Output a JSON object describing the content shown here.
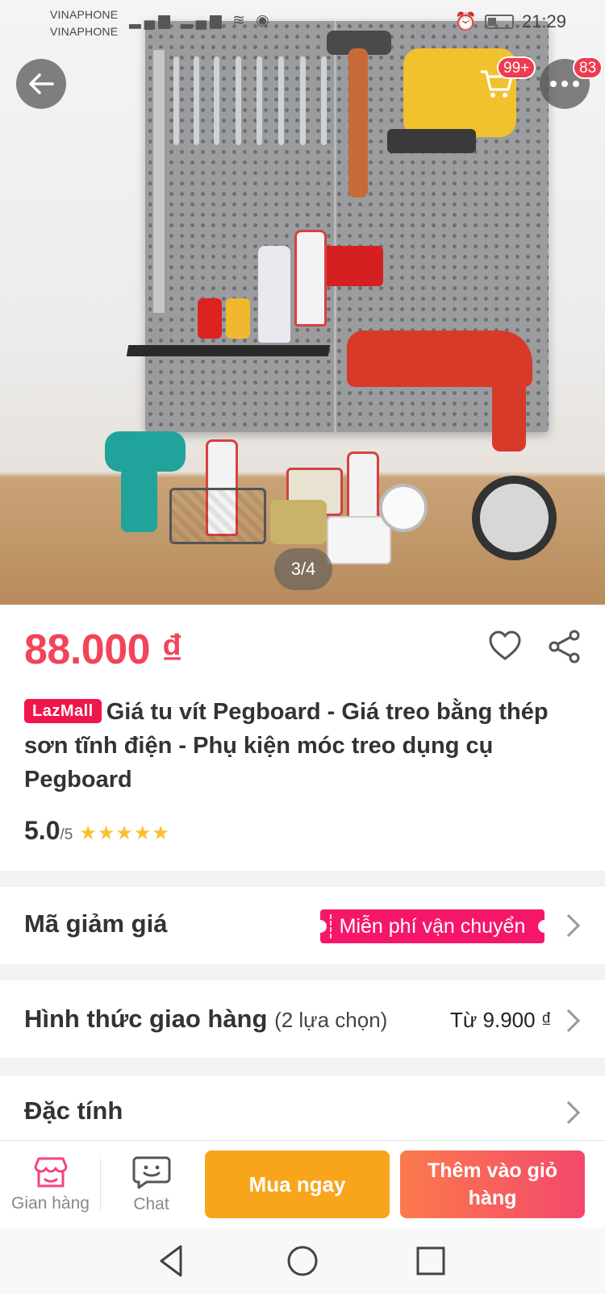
{
  "status_bar": {
    "carrier_1": "VINAPHONE",
    "carrier_2": "VINAPHONE",
    "time": "21:29"
  },
  "header": {
    "cart_badge": "99+",
    "more_badge": "83"
  },
  "gallery": {
    "counter": "3/4"
  },
  "product": {
    "price": "88.000 ₫",
    "mall_tag": "LazMall",
    "title": "Giá tu vít Pegboard - Giá treo bằng thép sơn tĩnh điện - Phụ kiện móc treo dụng cụ Pegboard",
    "rating_value": "5.0",
    "rating_max": "/5",
    "stars": 5
  },
  "voucher_row": {
    "label": "Mã giảm giá",
    "tag": "Miễn phí vận chuyển"
  },
  "shipping_row": {
    "label": "Hình thức giao hàng",
    "sub": "(2 lựa chọn)",
    "price": "Từ 9.900 ₫"
  },
  "spec_row": {
    "label": "Đặc tính"
  },
  "bottom_bar": {
    "store_label": "Gian hàng",
    "chat_label": "Chat",
    "buy_now": "Mua ngay",
    "add_to_cart": "Thêm vào giỏ hàng"
  },
  "colors": {
    "price": "#f0455a",
    "lazmall": "#f0154a",
    "buy_now": "#f8a51c",
    "add_to_cart_start": "#fb7a4c",
    "add_to_cart_end": "#f4486c",
    "store_icon": "#f5447a",
    "stars": "#fbbf2e"
  },
  "icons": {
    "back": "arrow-left-icon",
    "cart": "cart-icon",
    "more": "more-dots-icon",
    "favorite": "heart-icon",
    "share": "share-icon",
    "store": "store-icon",
    "chat": "chat-icon"
  }
}
